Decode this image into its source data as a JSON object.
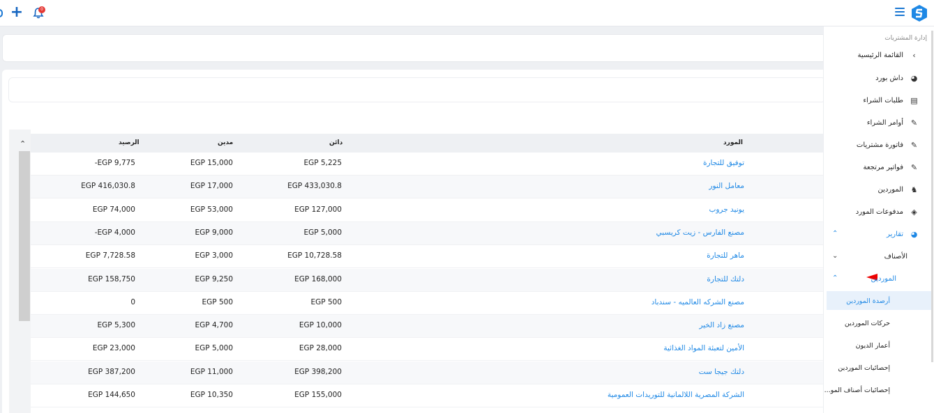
{
  "topbar": {
    "notif_count": "0"
  },
  "table": {
    "headers": {
      "supplier": "المورد",
      "credit": "دائن",
      "debit": "مدين",
      "balance": "الرصيد"
    },
    "rows": [
      {
        "supplier": "توفيق للتجارة",
        "credit": "EGP 5,225",
        "debit": "EGP 15,000",
        "balance": "-EGP 9,775"
      },
      {
        "supplier": "معامل النور",
        "credit": "EGP 433,030.8",
        "debit": "EGP 17,000",
        "balance": "EGP 416,030.8"
      },
      {
        "supplier": "يونيد جروب",
        "credit": "EGP 127,000",
        "debit": "EGP 53,000",
        "balance": "EGP 74,000"
      },
      {
        "supplier": "مصنع الفارس - زيت كريسبي",
        "credit": "EGP 5,000",
        "debit": "EGP 9,000",
        "balance": "-EGP 4,000"
      },
      {
        "supplier": "ماهر للتجارة",
        "credit": "EGP 10,728.58",
        "debit": "EGP 3,000",
        "balance": "EGP 7,728.58"
      },
      {
        "supplier": "دلتك للتجارة",
        "credit": "EGP 168,000",
        "debit": "EGP 9,250",
        "balance": "EGP 158,750"
      },
      {
        "supplier": "مصنع الشركه العالميه - سندباد",
        "credit": "EGP 500",
        "debit": "EGP 500",
        "balance": "0"
      },
      {
        "supplier": "مصنع زاد الخير",
        "credit": "EGP 10,000",
        "debit": "EGP 4,700",
        "balance": "EGP 5,300"
      },
      {
        "supplier": "الأمين لتعبئة المواد الغذائية",
        "credit": "EGP 28,000",
        "debit": "EGP 5,000",
        "balance": "EGP 23,000"
      },
      {
        "supplier": "دلتك جيجا ست",
        "credit": "EGP 398,200",
        "debit": "EGP 11,000",
        "balance": "EGP 387,200"
      },
      {
        "supplier": "الشركة المصرية اللالمانية للتوريدات العمومية",
        "credit": "EGP 155,000",
        "debit": "EGP 10,350",
        "balance": "EGP 144,650"
      }
    ]
  },
  "sidebar": {
    "section_title": "إدارة المشتريات",
    "items": [
      {
        "label": "القائمة الرئيسية",
        "icon": "chevron-left-icon"
      },
      {
        "label": "داش بورد",
        "icon": "gauge-icon"
      },
      {
        "label": "طلبات الشراء",
        "icon": "receipt-icon"
      },
      {
        "label": "أوامر الشراء",
        "icon": "order-icon"
      },
      {
        "label": "فاتورة مشتريات",
        "icon": "invoice-icon"
      },
      {
        "label": "فواتير مرتجعة",
        "icon": "return-invoice-icon"
      },
      {
        "label": "الموردين",
        "icon": "supplier-icon"
      },
      {
        "label": "مدفوعات المورد",
        "icon": "payment-icon"
      }
    ],
    "reports": {
      "label": "تقارير",
      "icon": "report-icon"
    },
    "items_group": {
      "label": "الأصناف"
    },
    "suppliers_group": {
      "label": "الموردين"
    },
    "sub_items": [
      "أرصدة الموردين",
      "حركات الموردين",
      "أعمار الديون",
      "إحصائيات الموردين",
      "إحصائيات أصناف المو..."
    ],
    "accent": "#1e88e5"
  }
}
